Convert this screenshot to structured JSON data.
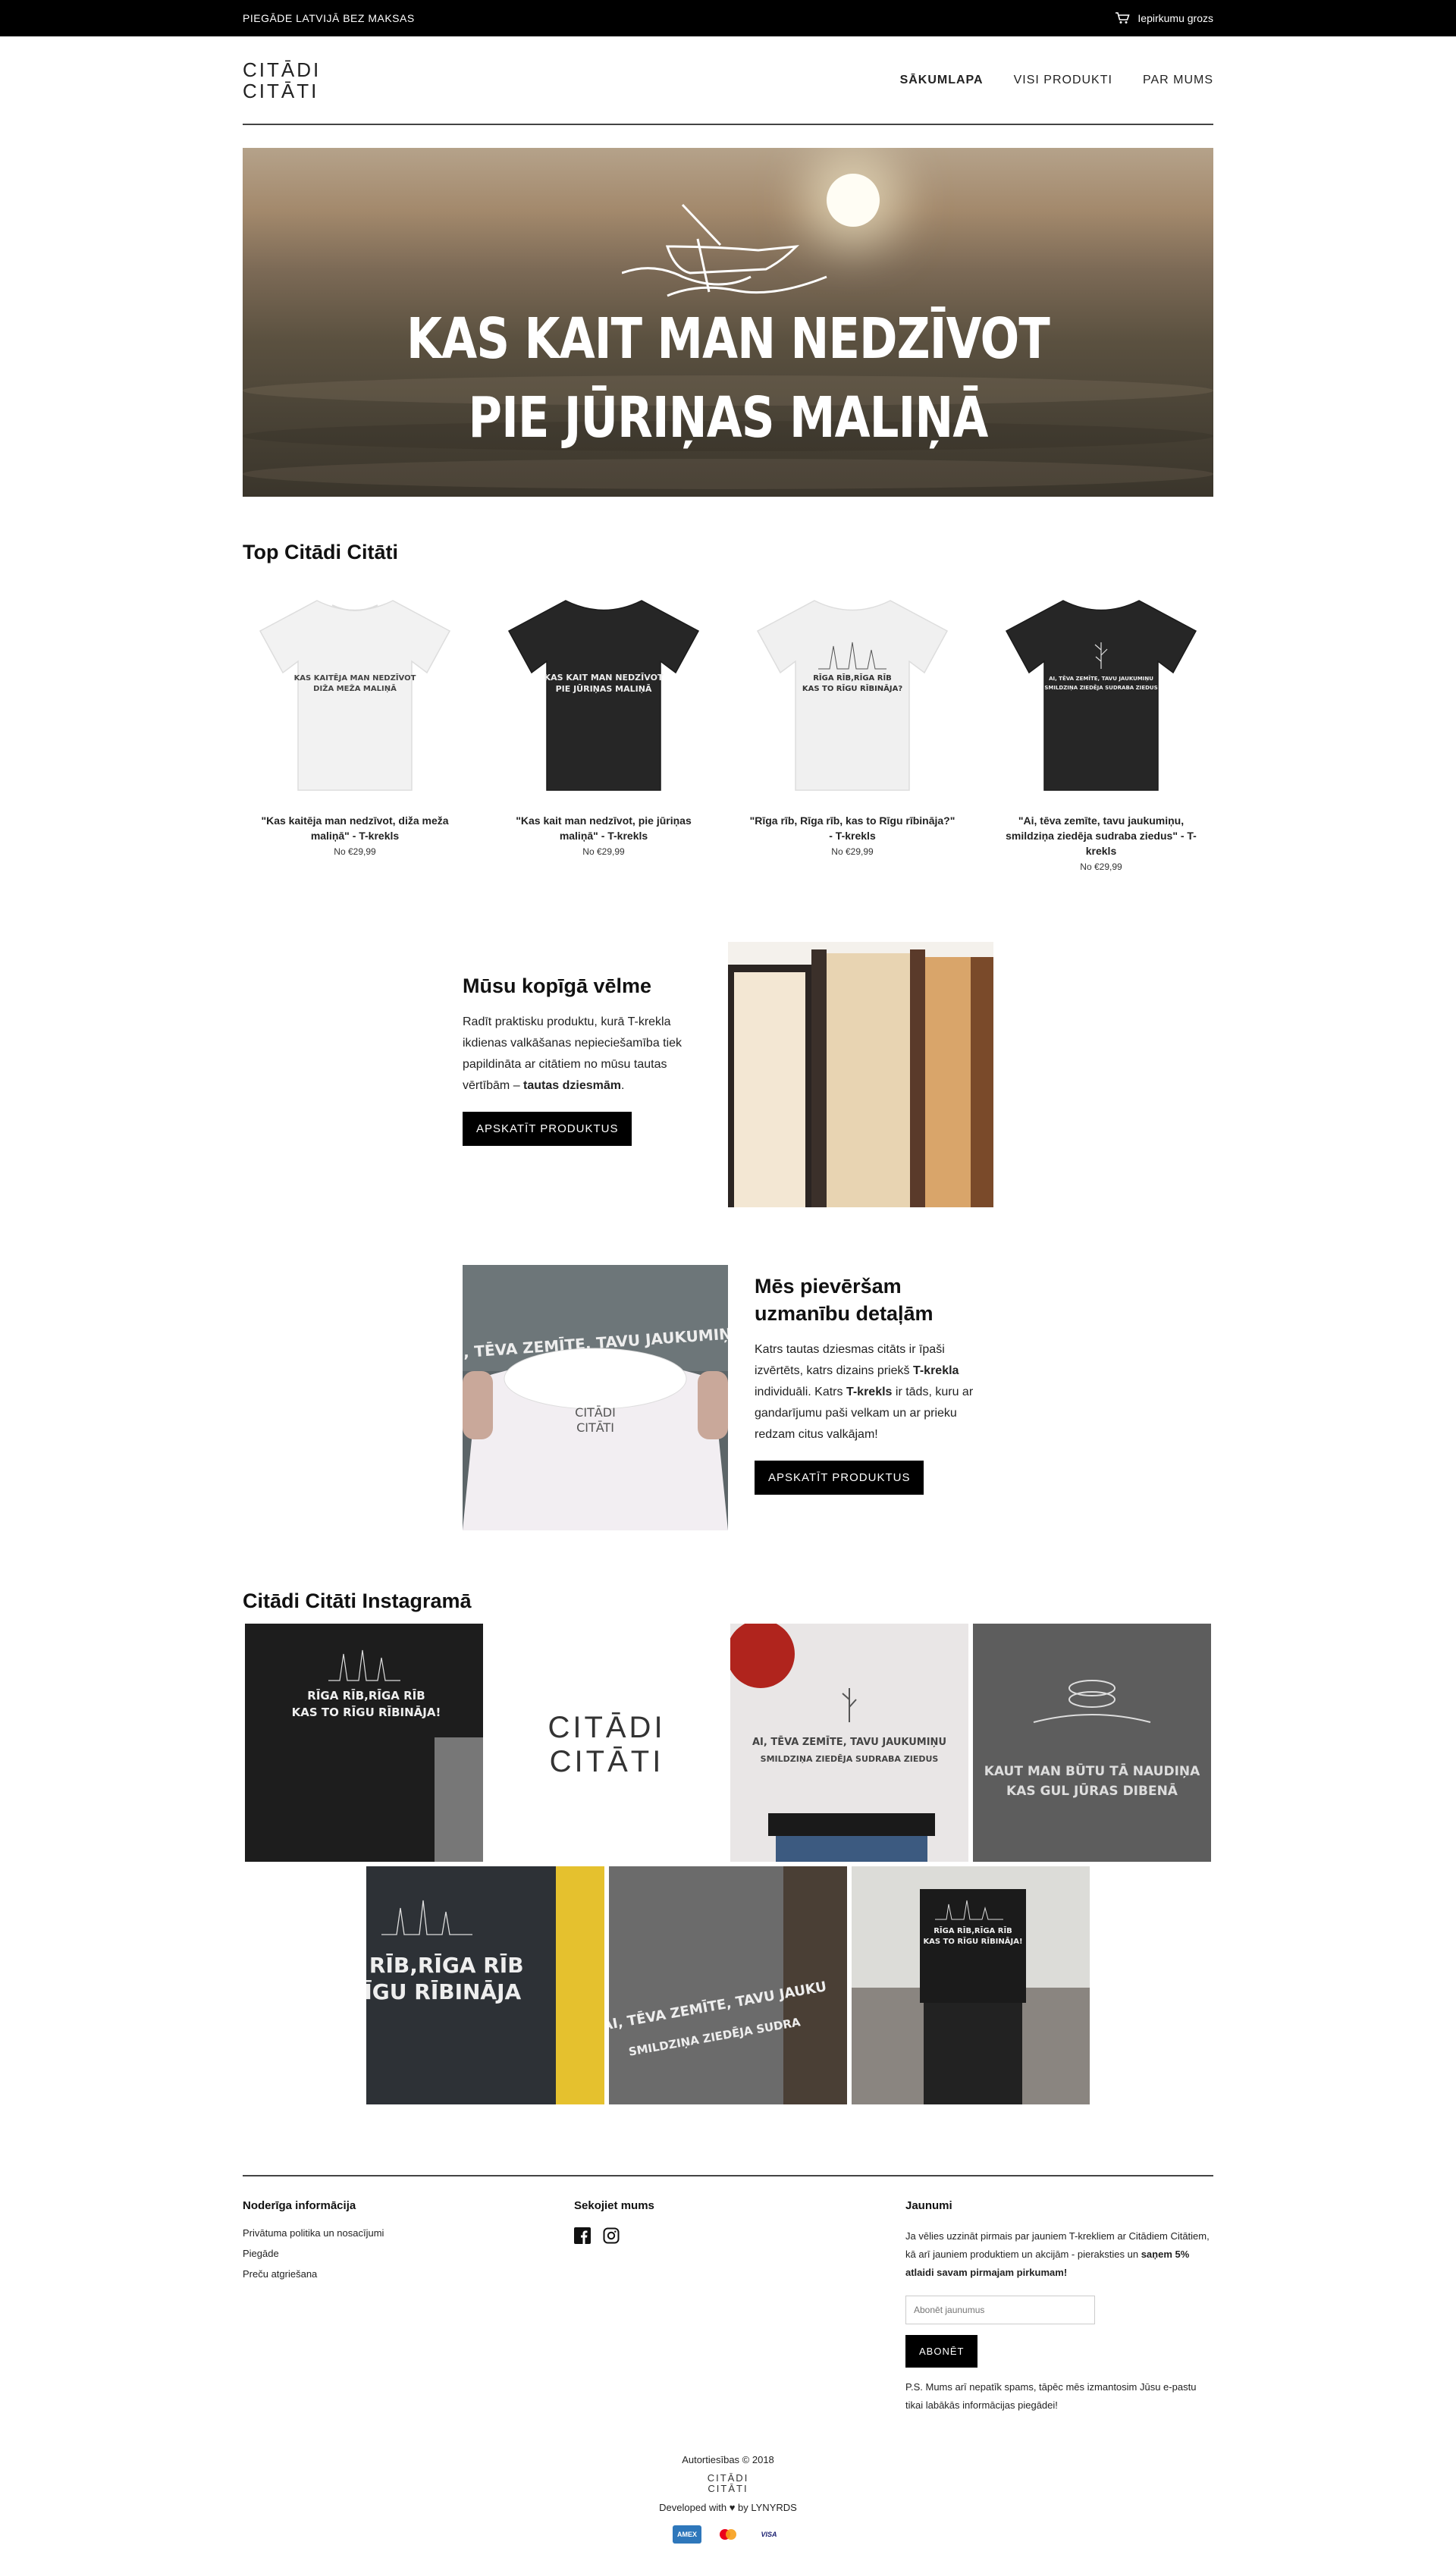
{
  "topbar": {
    "shipping": "PIEGĀDE LATVIJĀ BEZ MAKSAS",
    "cart_label": "Iepirkumu grozs",
    "cart_icon": "cart-icon"
  },
  "header": {
    "logo_line1": "CITĀDI",
    "logo_line2": "CITĀTI",
    "nav": [
      "SĀKUMLAPA",
      "VISI PRODUKTI",
      "PAR MUMS"
    ]
  },
  "hero": {
    "line1": "KAS KAIT MAN NEDZĪVOT",
    "line2": "PIE JŪRIŅAS MALIŅĀ"
  },
  "top_products": {
    "title": "Top Citādi Citāti",
    "items": [
      {
        "name": "\"Kas kaitēja man nedzīvot, diža meža maliņā\" - T-krekls",
        "price": "No €29,99",
        "shirt": "white",
        "print": "KAS KAITĒJA MAN NEDZĪVOT DIŽA MEŽA MALIŅĀ"
      },
      {
        "name": "\"Kas kait man nedzīvot, pie jūriņas maliņā\" - T-krekls",
        "price": "No €29,99",
        "shirt": "black",
        "print": "KAS KAIT MAN NEDZĪVOT PIE JŪRIŅAS MALIŅĀ"
      },
      {
        "name": "\"Rīga rīb, Rīga rīb, kas to Rīgu rībināja?\" - T-krekls",
        "price": "No €29,99",
        "shirt": "white",
        "print": "RĪGA RĪB,RĪGA RĪB KAS TO RĪGU RĪBINĀJA?"
      },
      {
        "name": "\"Ai, tēva zemīte, tavu jaukumiņu, smildziņa ziedēja sudraba ziedus\" - T-krekls",
        "price": "No €29,99",
        "shirt": "black",
        "print": "AI, TĒVA ZEMĪTE, TAVU JAUKUMIŅU SMILDZIŅA ZIEDĒJA SUDRABA ZIEDUS"
      }
    ]
  },
  "feature1": {
    "title": "Mūsu kopīgā vēlme",
    "text": "Radīt praktisku produktu, kurā T-krekla ikdienas valkāšanas nepieciešamība tiek papildināta ar citātiem no mūsu tautas vērtībām –",
    "bold": "tautas dziesmām",
    "end": ".",
    "button": "APSKATĪT PRODUKTUS"
  },
  "feature2": {
    "title": "Mēs pievēršam uzmanību detaļām",
    "t1": "Katrs tautas dziesmas citāts ir īpaši izvērtēts, katrs dizains priekš ",
    "b1": "T-krekla",
    "t2": " individuāli. Katrs ",
    "b2": "T-krekls",
    "t3": " ir tāds, kuru ar gandarījumu paši velkam un ar prieku redzam citus valkājam!",
    "button": "APSKATĪT PRODUKTUS",
    "shirt_print": "AI, TĒVA ZEMĪTE, TAVU JAUKUMIŅU"
  },
  "instagram": {
    "title": "Citādi Citāti Instagramā",
    "prints": {
      "p1": "RĪGA RĪB,RĪGA RĪB KAS TO RĪGU RĪBINĀJA!",
      "p3": "AI, TĒVA ZEMĪTE, TAVU JAUKUMIŅU SMILDZIŅA ZIEDĒJA SUDRABA ZIEDUS",
      "p4": "KAUT MAN BŪTU TĀ NAUDIŅA KAS GUL JŪRAS DIBENĀ",
      "p5": "A RĪB,RĪGA RĪB RĪGU RĪBINĀJA",
      "p6": "AI, TĒVA ZEMĪTE, TAVU JAUKU SMILDZIŅA ZIEDĒJA SUDRA",
      "p7": "RĪGA RĪB,RĪGA RĪB KAS TO RĪGU RĪBINĀJA!"
    }
  },
  "footer": {
    "col1_title": "Noderīga informācija",
    "col1_links": [
      "Privātuma politika un nosacījumi",
      "Piegāde",
      "Preču atgriešana"
    ],
    "col2_title": "Sekojiet mums",
    "col3_title": "Jaunumi",
    "col3_text": "Ja vēlies uzzināt pirmais par jauniem T-krekliem ar Citādiem Citātiem, kā arī jauniem produktiem un akcijām - pieraksties un ",
    "col3_bold": "saņem 5% atlaidi savam pirmajam pirkumam!",
    "email_placeholder": "Abonēt jaunumus",
    "subscribe": "ABONĒT",
    "ps": "P.S. Mums arī nepatīk spams, tāpēc mēs izmantosim Jūsu e-pastu tikai labākās informācijas piegādei!"
  },
  "bottom": {
    "copyright": "Autortiesības © 2018",
    "dev_prefix": "Developed with",
    "dev_suffix": "by LYNYRDS",
    "payments": [
      "AMEX",
      "MC",
      "VISA"
    ]
  }
}
